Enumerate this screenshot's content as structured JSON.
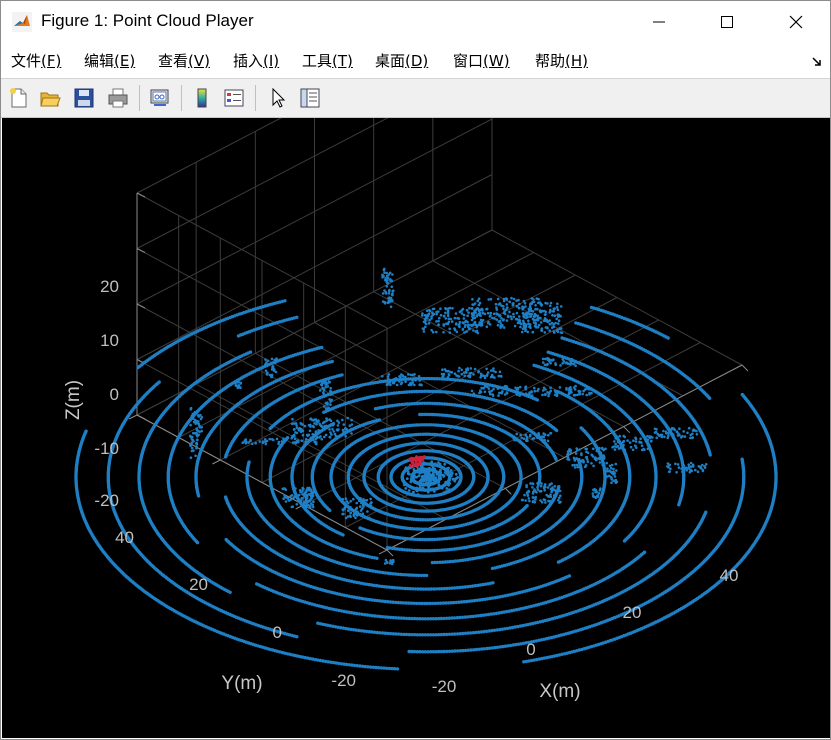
{
  "window": {
    "title": "Figure 1: Point Cloud Player",
    "app_icon": "matlab-icon",
    "controls": [
      "minimize-icon",
      "maximize-icon",
      "close-icon"
    ]
  },
  "menu": {
    "items": [
      {
        "label": "文件",
        "mnemonic": "(F)"
      },
      {
        "label": "编辑",
        "mnemonic": "(E)"
      },
      {
        "label": "查看",
        "mnemonic": "(V)"
      },
      {
        "label": "插入",
        "mnemonic": "(I)"
      },
      {
        "label": "工具",
        "mnemonic": "(T)"
      },
      {
        "label": "桌面",
        "mnemonic": "(D)"
      },
      {
        "label": "窗口",
        "mnemonic": "(W)"
      },
      {
        "label": "帮助",
        "mnemonic": "(H)"
      }
    ],
    "dock_icon": "dock-arrow-icon"
  },
  "toolbar": {
    "buttons": [
      "new-figure-icon",
      "open-file-icon",
      "save-icon",
      "print-icon",
      "link-plot-icon",
      "colorbar-icon",
      "legend-icon",
      "edit-plot-cursor-icon",
      "property-inspector-icon"
    ]
  },
  "plot": {
    "background": "#000000",
    "point_color": "#1f7fc4",
    "highlight_color": "#d0203a",
    "z_ticks": [
      "20",
      "10",
      "0",
      "-10",
      "-20"
    ],
    "y_ticks": [
      "40",
      "20",
      "0",
      "-20"
    ],
    "x_ticks": [
      "-20",
      "0",
      "20",
      "40"
    ],
    "x_label": "X(m)",
    "y_label": "Y(m)",
    "z_label": "Z(m)",
    "grid": true
  }
}
